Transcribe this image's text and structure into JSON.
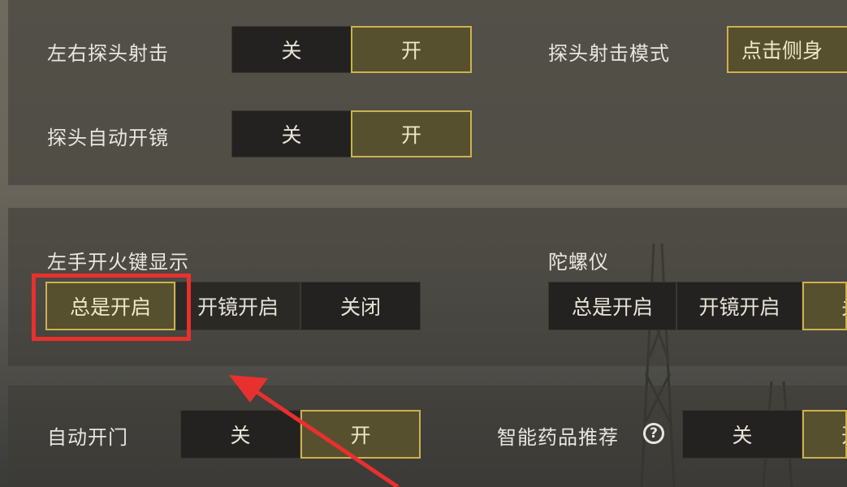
{
  "rows": {
    "peek_fire": {
      "label": "左右探头射击",
      "off": "关",
      "on": "开"
    },
    "peek_mode": {
      "label": "探头射击模式",
      "value": "点击侧身"
    },
    "peek_auto_scope": {
      "label": "探头自动开镜",
      "off": "关",
      "on": "开"
    },
    "left_fire_display": {
      "label": "左手开火键显示",
      "options": [
        "总是开启",
        "开镜开启",
        "关闭"
      ],
      "selected": "总是开启"
    },
    "gyroscope": {
      "label": "陀螺仪",
      "options": [
        "总是开启",
        "开镜开启",
        "关"
      ],
      "selected": "关"
    },
    "auto_door": {
      "label": "自动开门",
      "off": "关",
      "on": "开"
    },
    "smart_meds": {
      "label": "智能药品推荐",
      "help": "?",
      "off": "关",
      "on": "开"
    }
  },
  "annotation": {
    "highlight_color": "#e8302e",
    "arrow_color": "#e8302e"
  },
  "colors": {
    "selected_fill": "#57502f",
    "selected_border": "#cbb24e",
    "unselected_fill": "#232220"
  }
}
